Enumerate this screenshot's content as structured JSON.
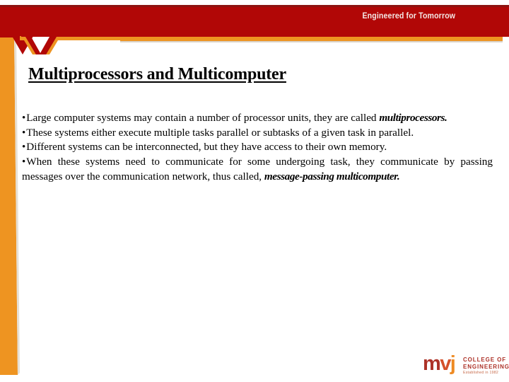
{
  "header": {
    "tagline": "Engineered for Tomorrow",
    "band_color": "#b10706",
    "accent_color": "#ee9421"
  },
  "slide": {
    "title": "Multiprocessors and Multicomputer",
    "bullets": [
      {
        "marker": "•",
        "justified": true,
        "runs": [
          {
            "text": "Large computer systems may contain a number of processor units, they are called ",
            "style": "normal"
          },
          {
            "text": "multiprocessors.",
            "style": "bold-italic"
          }
        ]
      },
      {
        "marker": "•",
        "justified": false,
        "runs": [
          {
            "text": "These systems either execute multiple tasks parallel or subtasks of a given task in parallel.",
            "style": "normal"
          }
        ]
      },
      {
        "marker": "•",
        "justified": false,
        "runs": [
          {
            "text": "Different systems can be interconnected, but they have access to their own memory.",
            "style": "normal"
          }
        ]
      },
      {
        "marker": "•",
        "justified": true,
        "runs": [
          {
            "text": "When these systems need to communicate for some undergoing task, they communicate by passing messages over the communication network, thus called, ",
            "style": "normal"
          },
          {
            "text": "message-passing multicomputer.",
            "style": "bold-italic"
          }
        ]
      }
    ]
  },
  "logo": {
    "mark_m": "m",
    "mark_v": "v",
    "mark_j": "j",
    "line1": "COLLEGE OF",
    "line2": "ENGINEERING",
    "line3": "Established in 1982",
    "color_m": "#ad3228",
    "color_v": "#d4502a",
    "color_j": "#ee8a22"
  }
}
